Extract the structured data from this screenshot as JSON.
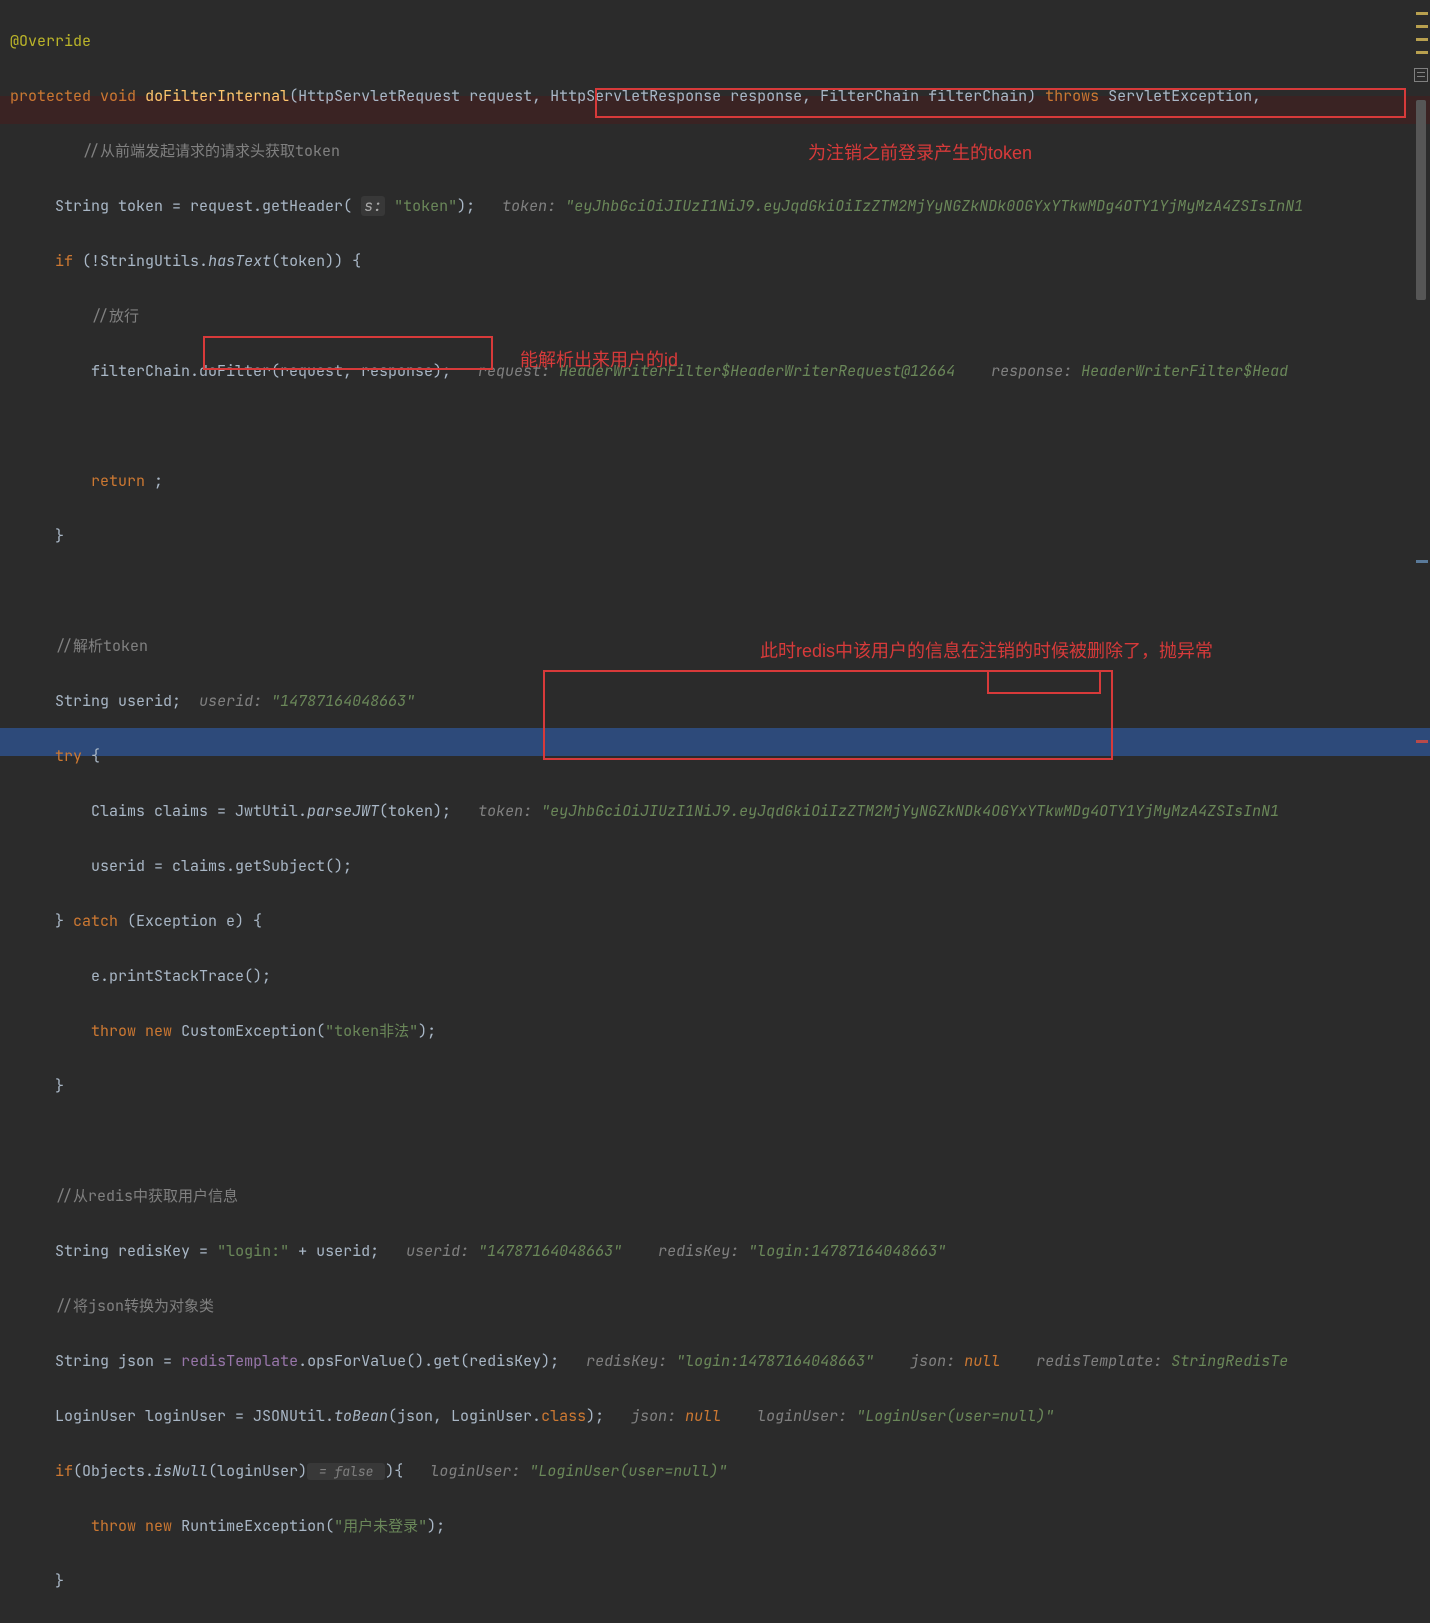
{
  "code": {
    "override": "@Override",
    "protected": "protected",
    "void": "void",
    "methodName": "doFilterInternal",
    "params": "(HttpServletRequest request, HttpServletResponse response, FilterChain filterChain)",
    "throws": "throws",
    "throwsTypes": "ServletException,",
    "comment1": "//从前端发起请求的请求头获取token",
    "stringType": "String",
    "tokenVar": "token = request.getHeader(",
    "paramHint_s": "s:",
    "tokenStr": "\"token\"",
    "tokenEnd": ");",
    "hint_token_label": "token:",
    "hint_token_val": "\"eyJhbGciOiJIUzI1NiJ9.eyJqdGkiOiIzZTM2MjYyNGZkNDk0OGYxYTkwMDg4OTY1YjMyMzA4ZSIsInN1",
    "ifLine": "if",
    "stringUtils": "(!StringUtils.",
    "hasText": "hasText",
    "hasTextEnd": "(token)) {",
    "comment2": "//放行",
    "filterChainCall": "filterChain.doFilter(request, response);",
    "hint_request_label": "request:",
    "hint_request_val": "HeaderWriterFilter$HeaderWriterRequest@12664",
    "hint_response_label": "response:",
    "hint_response_val": "HeaderWriterFilter$Head",
    "return": "return",
    "returnEnd": " ;",
    "brace": "}",
    "comment3": "//解析token",
    "useridDecl": "userid;",
    "hint_userid_label": "userid:",
    "hint_userid_val": "\"14787164048663\"",
    "try": "try",
    "tryBrace": " {",
    "claimsLine": "Claims claims = JwtUtil.",
    "parseJWT": "parseJWT",
    "parseJWTEnd": "(token);",
    "hint_token2_val": "\"eyJhbGciOiJIUzI1NiJ9.eyJqdGkiOiIzZTM2MjYyNGZkNDk4OGYxYTkwMDg4OTY1YjMyMzA4ZSIsInN1",
    "useridAssign": "userid = claims.getSubject();",
    "catch": "catch",
    "catchParams": " (Exception e) {",
    "printStack": "e.printStackTrace();",
    "throw": "throw",
    "new": "new",
    "customEx": "CustomException(",
    "tokenIllegal": "\"token非法\"",
    "customExEnd": ");",
    "comment4": "//从redis中获取用户信息",
    "redisKeyLine": "redisKey = ",
    "loginStr": "\"login:\"",
    "plusUserid": " + userid;",
    "hint_redisKey_label": "redisKey:",
    "hint_redisKey_val": "\"login:14787164048663\"",
    "comment5": "//将json转换为对象类",
    "jsonLine": "json = ",
    "redisTemplate": "redisTemplate",
    "opsForValue": ".opsForValue().get(redisKey);",
    "hint_json_label": "json:",
    "hint_json_null": "null",
    "hint_redisTemplate_label": "redisTemplate:",
    "hint_redisTemplate_val": "StringRedisTe",
    "loginUserLine": "LoginUser loginUser = JSONUtil.",
    "toBean": "toBean",
    "toBeanEnd": "(json, LoginUser.",
    "classKw": "class",
    "toBeanClose": ");",
    "hint_loginUser_label": "loginUser:",
    "hint_loginUser_val": "\"LoginUser(user=null)\"",
    "ifObjects": "(Objects.",
    "isNull": "isNull",
    "isNullEnd": "(loginUser)",
    "inlineFalse": " = false ",
    "ifBrace": "){",
    "runtimeEx": "RuntimeException(",
    "notLoggedIn": "\"用户未登录\"",
    "runtimeExEnd": ");"
  },
  "annotations": {
    "label1": "为注销之前登录产生的token",
    "label2": "能解析出来用户的id",
    "label3": "此时redis中该用户的信息在注销的时候被删除了，抛异常"
  }
}
